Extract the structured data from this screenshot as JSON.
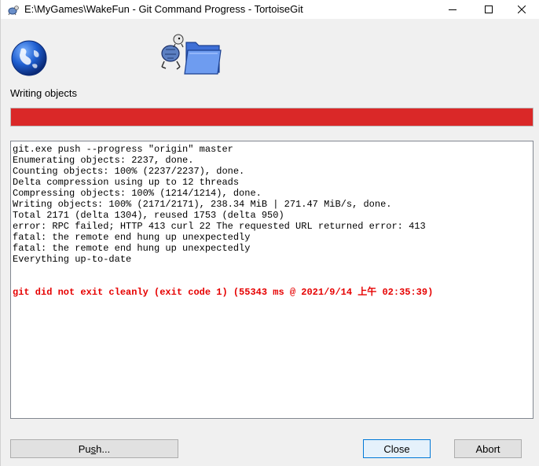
{
  "window": {
    "title": "E:\\MyGames\\WakeFun - Git Command Progress - TortoiseGit"
  },
  "icons": {
    "app": "tortoisegit-icon",
    "globe": "globe-icon",
    "animation": "turtle-folder-icon"
  },
  "progress": {
    "label": "Writing objects",
    "percent": 100,
    "color": "#da2828"
  },
  "log": {
    "lines": [
      "git.exe push --progress \"origin\" master",
      "Enumerating objects: 2237, done.",
      "Counting objects: 100% (2237/2237), done.",
      "Delta compression using up to 12 threads",
      "Compressing objects: 100% (1214/1214), done.",
      "Writing objects: 100% (2171/2171), 238.34 MiB | 271.47 MiB/s, done.",
      "Total 2171 (delta 1304), reused 1753 (delta 950)",
      "error: RPC failed; HTTP 413 curl 22 The requested URL returned error: 413",
      "fatal: the remote end hung up unexpectedly",
      "fatal: the remote end hung up unexpectedly",
      "Everything up-to-date"
    ],
    "error_message": "git did not exit cleanly (exit code 1) (55343 ms @ 2021/9/14 上午 02:35:39)",
    "error_color": "#e60000"
  },
  "buttons": {
    "push_pre": "Pu",
    "push_underlined": "s",
    "push_post": "h...",
    "close": "Close",
    "abort": "Abort"
  }
}
